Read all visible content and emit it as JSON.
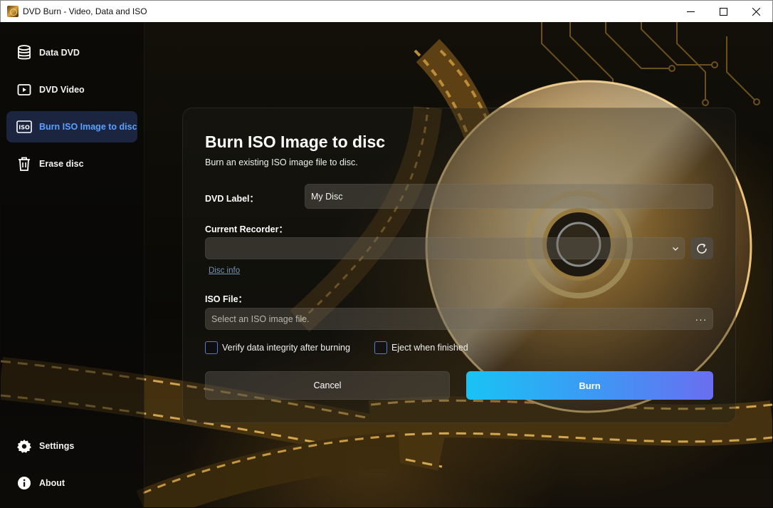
{
  "window": {
    "title": "DVD Burn - Video, Data and ISO"
  },
  "sidebar": {
    "items": [
      {
        "label": "Data DVD",
        "icon": "database-icon",
        "active": false
      },
      {
        "label": "DVD Video",
        "icon": "video-icon",
        "active": false
      },
      {
        "label": "Burn ISO Image to disc",
        "icon": "iso-icon",
        "active": true
      },
      {
        "label": "Erase disc",
        "icon": "trash-icon",
        "active": false
      }
    ],
    "bottom_items": [
      {
        "label": "Settings",
        "icon": "gear-icon"
      },
      {
        "label": "About",
        "icon": "info-icon"
      }
    ]
  },
  "main": {
    "title": "Burn ISO Image to disc",
    "subtitle": "Burn an existing ISO image file to disc.",
    "dvd_label": {
      "label": "DVD Label：",
      "value": "My Disc"
    },
    "recorder": {
      "label": "Current Recorder：",
      "value": "",
      "disc_info_link": "Disc info"
    },
    "iso_file": {
      "label": "ISO File：",
      "placeholder": "Select an ISO image file.",
      "browse_label": "···"
    },
    "options": {
      "verify": {
        "label": "Verify data integrity after burning",
        "checked": false
      },
      "eject": {
        "label": "Eject when finished",
        "checked": false
      }
    },
    "buttons": {
      "cancel": "Cancel",
      "burn": "Burn"
    }
  },
  "colors": {
    "accent_active_text": "#5aa0ff",
    "active_nav_bg": "#1b2540",
    "burn_gradient_start": "#19c3f5",
    "burn_gradient_end": "#6a6ef0"
  }
}
